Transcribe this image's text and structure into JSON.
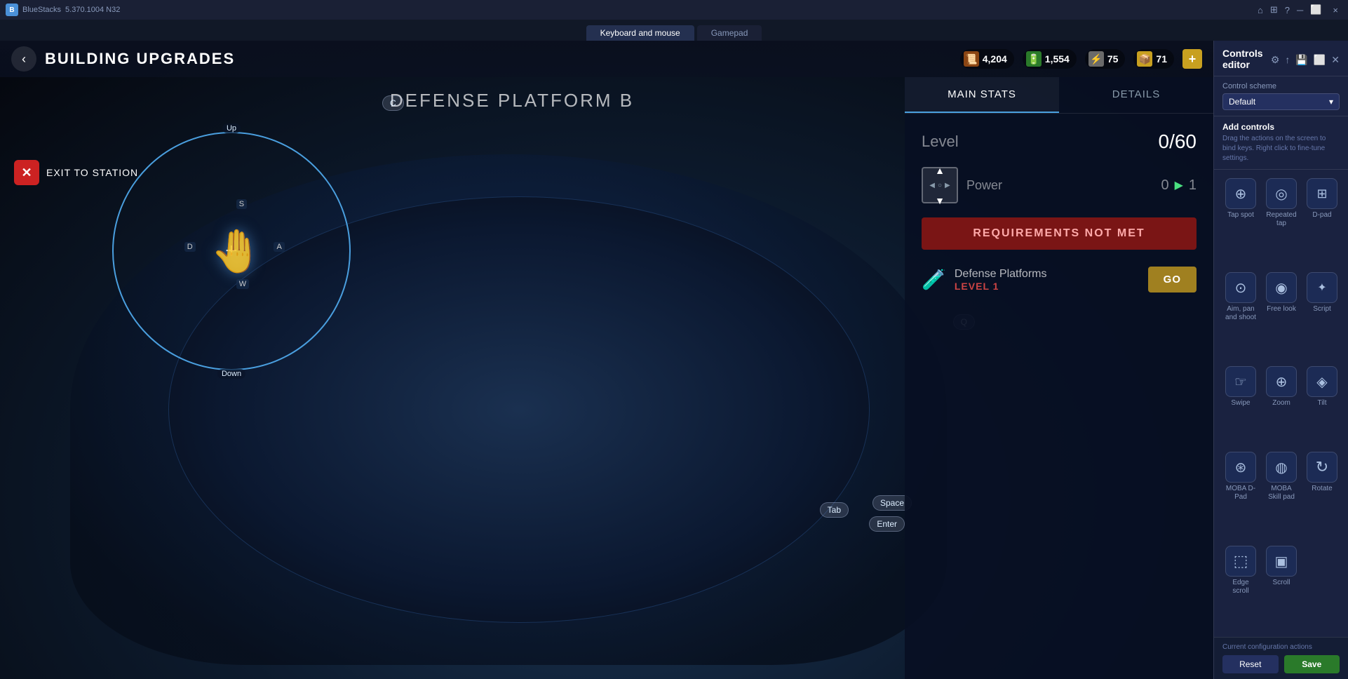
{
  "titleBar": {
    "appName": "BlueStacks",
    "version": "5.370.1004 N32",
    "icons": [
      "home",
      "grid",
      "question",
      "minus",
      "restore",
      "close"
    ],
    "closeLabel": "×"
  },
  "tabs": [
    {
      "id": "keyboard",
      "label": "Keyboard and mouse",
      "active": true
    },
    {
      "id": "gamepad",
      "label": "Gamepad",
      "active": false
    }
  ],
  "gameTopBar": {
    "backLabel": "‹",
    "pageTitle": "BUILDING UPGRADES",
    "resources": [
      {
        "id": "scroll",
        "icon": "📜",
        "value": "4,204",
        "color": "#8b4513"
      },
      {
        "id": "battery",
        "icon": "🔋",
        "value": "1,554",
        "color": "#2a7a2a"
      },
      {
        "id": "bolt",
        "icon": "⚡",
        "value": "75",
        "color": "#6a6a6a"
      },
      {
        "id": "gold",
        "icon": "📦",
        "value": "71",
        "color": "#c8a020"
      }
    ],
    "addBtn": "+"
  },
  "game": {
    "buildingName": "DEFENSE PLATFORM B",
    "exitLabel": "EXIT TO STATION",
    "controlCircle": {
      "labelUp": "Up",
      "labelDown": "Down",
      "keyS": "S",
      "keyW": "W",
      "keyD": "D",
      "keyA": "A"
    },
    "floatingKeys": {
      "c": "C",
      "q": "Q",
      "space": "Space",
      "tab": "Tab",
      "enter": "Enter"
    }
  },
  "statsPanel": {
    "tabs": [
      {
        "id": "main",
        "label": "MAIN STATS",
        "active": true
      },
      {
        "id": "details",
        "label": "DETAILS",
        "active": false
      }
    ],
    "levelLabel": "Level",
    "levelValue": "0/60",
    "powerLabel": "Power",
    "powerFrom": "0",
    "powerTo": "1",
    "requirementsNotMet": "REQUIREMENTS NOT MET",
    "requirementName": "Defense Platforms",
    "requirementLevel": "LEVEL 1",
    "goButton": "GO"
  },
  "controlsEditor": {
    "title": "Controls editor",
    "headerIcons": [
      "settings",
      "upload",
      "save",
      "maximize",
      "close"
    ],
    "schemeLabel": "Control scheme",
    "schemeValue": "Default",
    "addControlsTitle": "Add controls",
    "addControlsDesc": "Drag the actions on the screen to bind keys. Right click to fine-tune settings.",
    "controls": [
      {
        "id": "tap-spot",
        "icon": "⊕",
        "label": "Tap spot"
      },
      {
        "id": "repeated-tap",
        "icon": "◎",
        "label": "Repeated tap"
      },
      {
        "id": "d-pad",
        "icon": "⊞",
        "label": "D-pad"
      },
      {
        "id": "aim-pan-shoot",
        "icon": "⊙",
        "label": "Aim, pan and shoot"
      },
      {
        "id": "free-look",
        "icon": "◉",
        "label": "Free look"
      },
      {
        "id": "script",
        "icon": "✦",
        "label": "Script"
      },
      {
        "id": "swipe",
        "icon": "☞",
        "label": "Swipe"
      },
      {
        "id": "zoom",
        "icon": "⊕",
        "label": "Zoom"
      },
      {
        "id": "tilt",
        "icon": "◈",
        "label": "Tilt"
      },
      {
        "id": "moba-dpad",
        "icon": "⊛",
        "label": "MOBA D-Pad"
      },
      {
        "id": "moba-skill",
        "icon": "◍",
        "label": "MOBA Skill pad"
      },
      {
        "id": "rotate",
        "icon": "↻",
        "label": "Rotate"
      },
      {
        "id": "edge-scroll",
        "icon": "⬚",
        "label": "Edge scroll"
      },
      {
        "id": "scroll",
        "icon": "▣",
        "label": "Scroll"
      }
    ],
    "footerLabel": "Current configuration actions",
    "resetLabel": "Reset",
    "saveLabel": "Save"
  }
}
